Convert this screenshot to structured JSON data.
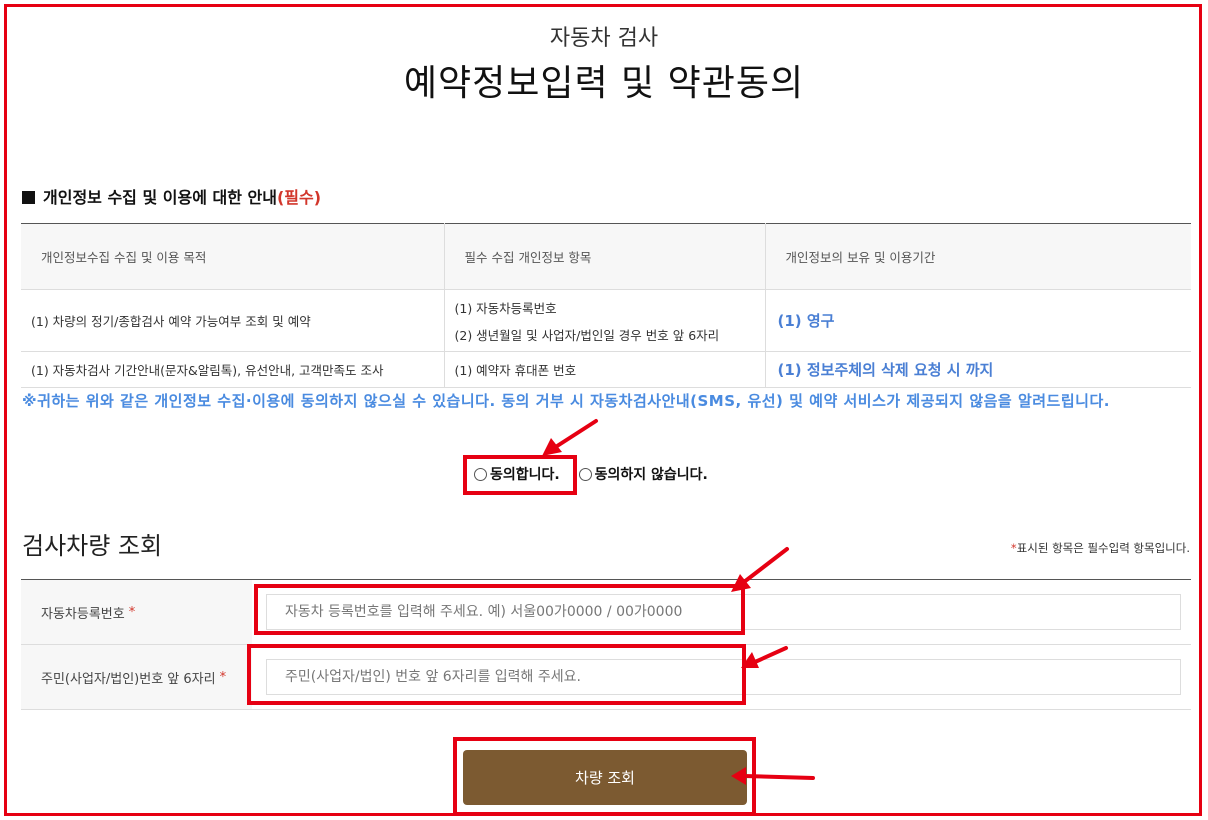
{
  "header": {
    "subtitle": "자동차 검사",
    "title": "예약정보입력 및 약관동의"
  },
  "privacy": {
    "heading": "개인정보 수집 및 이용에 대한 안내",
    "required_tag": "(필수)",
    "columns": [
      "개인정보수집 수집 및 이용 목적",
      "필수 수집 개인정보 항목",
      "개인정보의 보유 및 이용기간"
    ],
    "rows": [
      {
        "purpose": "(1) 차량의 정기/종합검사 예약 가능여부 조회 및 예약",
        "items": [
          "(1) 자동차등록번호",
          "(2) 생년월일 및 사업자/법인일 경우 번호 앞 6자리"
        ],
        "period": "(1) 영구"
      },
      {
        "purpose": "(1) 자동차검사 기간안내(문자&알림톡), 유선안내, 고객만족도 조사",
        "items": [
          "(1) 예약자 휴대폰 번호"
        ],
        "period": "(1) 정보주체의 삭제 요청 시 까지"
      }
    ],
    "notice": "※귀하는 위와 같은 개인정보 수집·이용에 동의하지 않으실 수 있습니다. 동의 거부 시 자동차검사안내(SMS, 유선) 및 예약 서비스가 제공되지 않음을 알려드립니다.",
    "agree_label": "동의합니다.",
    "disagree_label": "동의하지 않습니다."
  },
  "vehicle": {
    "title": "검사차량 조회",
    "required_note_star": "*",
    "required_note": "표시된 항목은 필수입력 항목입니다.",
    "reg_label": "자동차등록번호",
    "reg_placeholder": "자동차 등록번호를 입력해 주세요. 예) 서울00가0000 / 00가0000",
    "id_label": "주민(사업자/법인)번호 앞 6자리",
    "id_placeholder": "주민(사업자/법인) 번호 앞 6자리를 입력해 주세요.",
    "star": "*",
    "submit_label": "차량 조회"
  },
  "colors": {
    "highlight": "#e60012",
    "notice_blue": "#4a8be0",
    "button_brown": "#7c5a31",
    "required_red": "#d2362b"
  },
  "icons": {
    "section_marker": "filled-square-icon",
    "annotation": "red-arrow-icon"
  }
}
